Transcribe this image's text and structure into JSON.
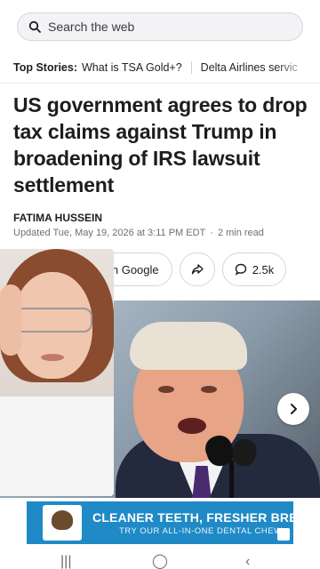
{
  "search": {
    "placeholder": "Search the web",
    "icon": "search-icon"
  },
  "stories": {
    "label": "Top Stories:",
    "items": [
      "What is TSA Gold+?",
      "Delta Airlines servic"
    ]
  },
  "article": {
    "headline": "US government agrees to drop tax claims against Trump in broadening of IRS lawsuit settlement",
    "author": "FATIMA HUSSEIN",
    "updated": "Updated Tue, May 19, 2026 at 3:11 PM EDT",
    "read_time": "2 min read"
  },
  "actions": {
    "follow_label": "hoo on Google",
    "share_icon": "share-icon",
    "comments_count": "2.5k"
  },
  "ad": {
    "title": "CLEANER TEETH, FRESHER BREATH",
    "subtitle": "TRY OUR ALL-IN-ONE DENTAL CHEW",
    "accent": "#1f8ac6"
  },
  "navbar": {
    "recents": "|||",
    "home": "◯",
    "back": "‹"
  }
}
